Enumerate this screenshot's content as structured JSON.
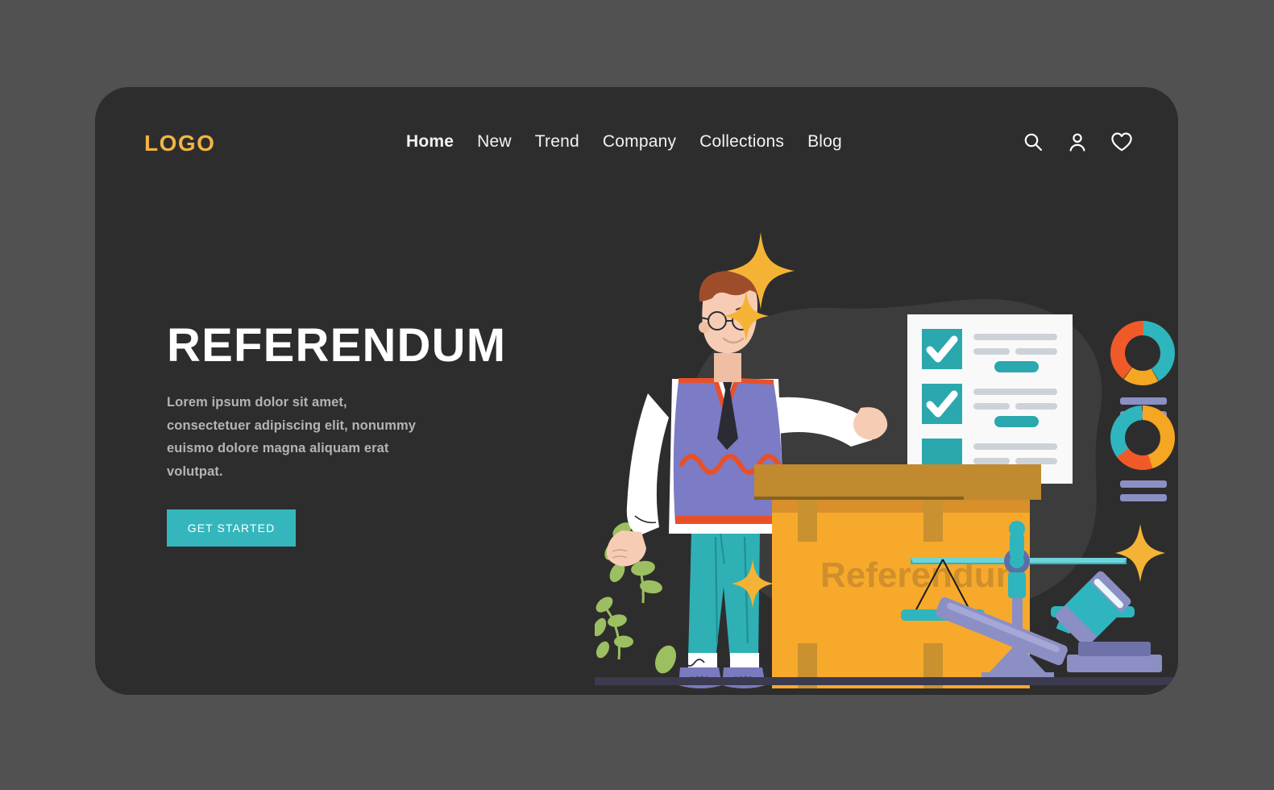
{
  "page": {
    "background_color": "#515151",
    "card_color": "#2e2d2d"
  },
  "header": {
    "logo": "LOGO",
    "logo_color": "#f2b443",
    "nav": [
      {
        "label": "Home",
        "active": true
      },
      {
        "label": "New",
        "active": false
      },
      {
        "label": "Trend",
        "active": false
      },
      {
        "label": "Company",
        "active": false
      },
      {
        "label": "Collections",
        "active": false
      },
      {
        "label": "Blog",
        "active": false
      }
    ],
    "actions": [
      {
        "icon": "search-icon",
        "label": "Search"
      },
      {
        "icon": "user-icon",
        "label": "Account"
      },
      {
        "icon": "heart-icon",
        "label": "Favorites"
      }
    ]
  },
  "hero": {
    "title": "REFERENDUM",
    "subtitle": "Lorem ipsum dolor sit amet, consectetuer adipiscing elit, nonummy euismo dolore magna aliquam erat volutpat.",
    "cta_label": "GET STARTED",
    "cta_color": "#35b6bd",
    "title_color": "#ffffff",
    "subtitle_color": "#b4b4b4"
  },
  "illustration": {
    "name": "referendum-voting-scene",
    "ballot_box_label": "Referendum",
    "ballot_box_color": "#f7a92b",
    "ballot_box_lid_color": "#c18a2e",
    "ballot_box_label_color": "#cf8f2c",
    "blob_color": "#3d3c3c",
    "checklist": {
      "paper_color": "#f9f9f9",
      "checkbox_color": "#2ba7ae",
      "checkmark_color": "#ffffff",
      "line_color": "#cdd2d8",
      "accent_line_color": "#2ba7ae",
      "items": [
        {
          "checked": true
        },
        {
          "checked": true
        },
        {
          "checked": true
        }
      ]
    },
    "donut_charts": [
      {
        "name": "donut-chart-top",
        "segments": [
          {
            "color": "#2fb5bd",
            "value": 42
          },
          {
            "color": "#f5a623",
            "value": 18
          },
          {
            "color": "#f05a28",
            "value": 40
          }
        ]
      },
      {
        "name": "donut-chart-bottom",
        "segments": [
          {
            "color": "#f5a623",
            "value": 45
          },
          {
            "color": "#f05a28",
            "value": 20
          },
          {
            "color": "#2fb5bd",
            "value": 35
          }
        ]
      }
    ],
    "bar_color": "#8b8fc4",
    "character": {
      "name": "man-presenting-checklist",
      "hair_color": "#9e4d2b",
      "skin_color": "#f6cdb4",
      "vest_color": "#7b7bc6",
      "shirt_color": "#ffffff",
      "tie_color": "#2b2b33",
      "accent_color": "#e8502a",
      "pants_color": "#2fb0b5",
      "shoes_color": "#7a7ac0",
      "sock_color": "#ffffff"
    },
    "scales": {
      "name": "scales-of-justice",
      "beam_color": "#2fb5bd",
      "stand_color": "#8b8fc4"
    },
    "gavel": {
      "name": "gavel",
      "head_color": "#2fb5bd",
      "handle_color": "#8b8fc4",
      "base_color": "#6e72a8"
    },
    "plant_color": "#9cbf61",
    "sparkle_color": "#f5b335",
    "ground_color": "#3b3a4e"
  }
}
